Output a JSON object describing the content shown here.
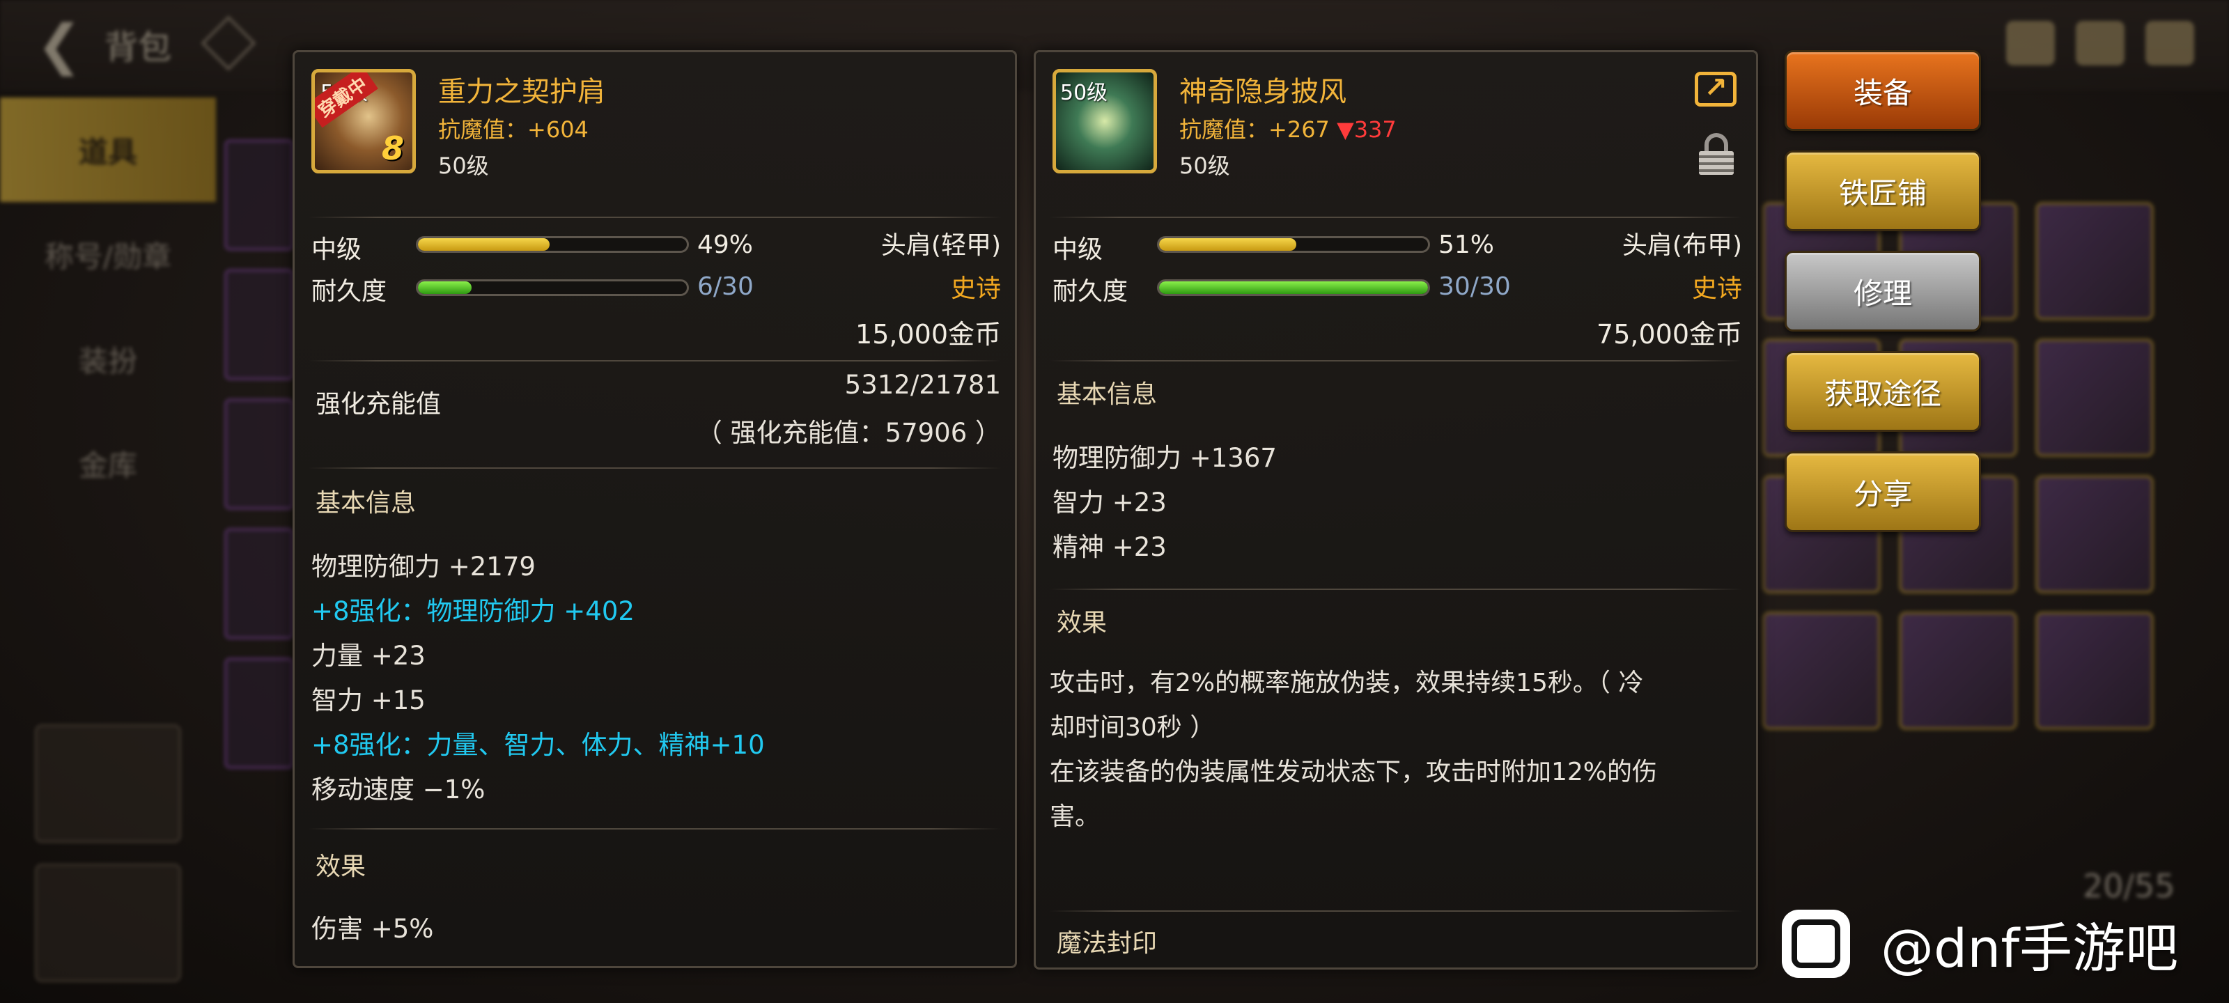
{
  "header": {
    "title": "背包"
  },
  "left_tabs": [
    "道具",
    "称号/勋章",
    "装扮",
    "金库"
  ],
  "bag_count": "20/55",
  "left_item": {
    "level_badge": "50级",
    "wear_badge": "穿戴中",
    "enhance": "8",
    "name": "重力之契护肩",
    "magic_resist_label": "抗魔值：",
    "magic_resist": "+604",
    "level": "50级",
    "grade_label": "中级",
    "grade_pct": "49%",
    "grade_value": 0.49,
    "slot_type": "头肩(轻甲)",
    "durability_label": "耐久度",
    "durability": "6/30",
    "durability_value": 0.2,
    "rarity": "史诗",
    "price": "15,000金币",
    "charge_label": "强化充能值",
    "charge_value": "5312/21781",
    "charge_total": "（ 强化充能值：57906 ）",
    "basic_title": "基本信息",
    "attrs": [
      "物理防御力 +2179",
      "+8强化：物理防御力 +402",
      "力量 +23",
      "智力 +15",
      "+8强化：力量、智力、体力、精神+10",
      "移动速度 −1%"
    ],
    "effect_title": "效果",
    "effect": "伤害 +5%"
  },
  "right_item": {
    "level_badge": "50级",
    "name": "神奇隐身披风",
    "magic_resist_label": "抗魔值：",
    "magic_resist": "+267",
    "magic_resist_diff": "▼337",
    "level": "50级",
    "grade_label": "中级",
    "grade_pct": "51%",
    "grade_value": 0.51,
    "slot_type": "头肩(布甲)",
    "durability_label": "耐久度",
    "durability": "30/30",
    "durability_value": 1.0,
    "rarity": "史诗",
    "price": "75,000金币",
    "basic_title": "基本信息",
    "attrs": [
      "物理防御力 +1367",
      "智力 +23",
      "精神 +23"
    ],
    "effect_title": "效果",
    "effect_lines": [
      "攻击时，有2%的概率施放伪装，效果持续15秒。（ 冷",
      "却时间30秒 ）",
      "在该装备的伪装属性发动状态下，攻击时附加12%的伤",
      "害。"
    ],
    "seal_title": "魔法封印"
  },
  "actions": [
    "装备",
    "铁匠铺",
    "修理",
    "获取途径",
    "分享"
  ],
  "watermark": {
    "text": "@dnf手游吧"
  },
  "colors": {
    "gold": "#f2b43a",
    "cyan": "#21c9f0",
    "down": "#ff3b3b",
    "rarity": "#f2a820"
  }
}
